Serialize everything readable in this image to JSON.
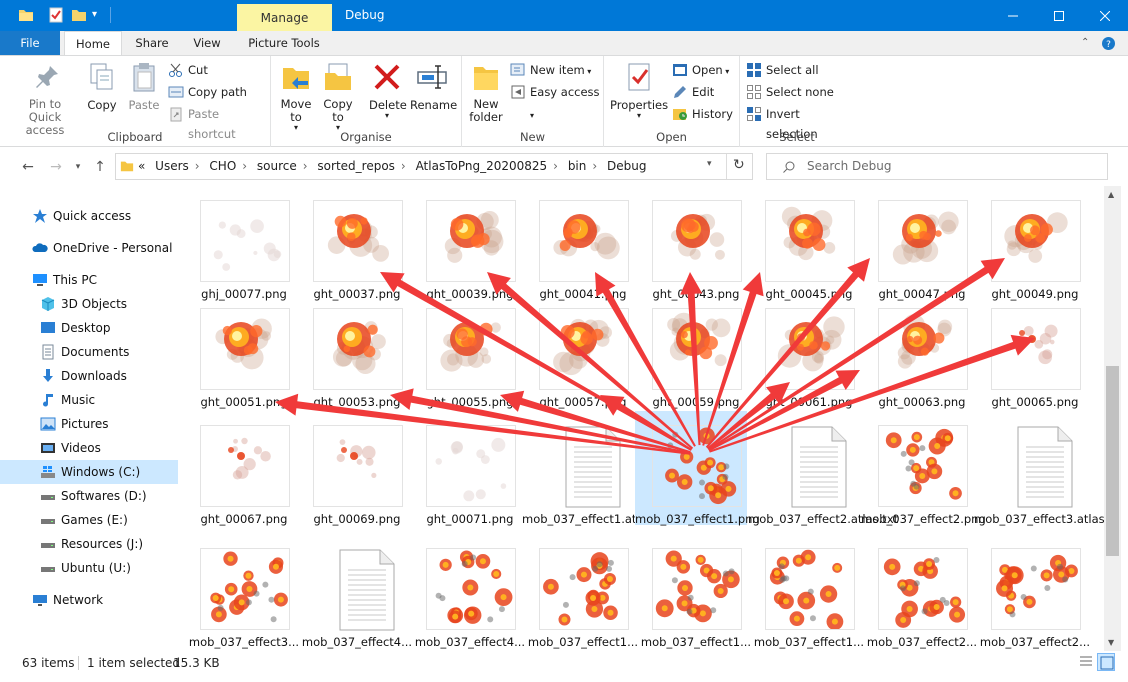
{
  "window": {
    "title": "Debug",
    "contextual_tab": "Manage",
    "accent": "#0078d7"
  },
  "ribbon_tabs": [
    "File",
    "Home",
    "Share",
    "View",
    "Picture Tools"
  ],
  "ribbon": {
    "clipboard": {
      "label": "Clipboard",
      "pin": "Pin to Quick access",
      "copy": "Copy",
      "paste": "Paste",
      "cut": "Cut",
      "copy_path": "Copy path",
      "paste_shortcut": "Paste shortcut"
    },
    "organise": {
      "label": "Organise",
      "move_to": "Move to",
      "copy_to": "Copy to",
      "delete": "Delete",
      "rename": "Rename"
    },
    "new": {
      "label": "New",
      "new_folder": "New folder",
      "new_item": "New item",
      "easy_access": "Easy access"
    },
    "open": {
      "label": "Open",
      "properties": "Properties",
      "open": "Open",
      "edit": "Edit",
      "history": "History"
    },
    "select": {
      "label": "Select",
      "select_all": "Select all",
      "select_none": "Select none",
      "invert": "Invert selection"
    }
  },
  "address": {
    "crumbs": [
      "«",
      "Users",
      "CHO",
      "source",
      "sorted_repos",
      "AtlasToPng_20200825",
      "bin",
      "Debug"
    ],
    "search_placeholder": "Search Debug"
  },
  "nav": {
    "quick_access": "Quick access",
    "onedrive": "OneDrive - Personal",
    "this_pc": "This PC",
    "objects": "3D Objects",
    "desktop": "Desktop",
    "documents": "Documents",
    "downloads": "Downloads",
    "music": "Music",
    "pictures": "Pictures",
    "videos": "Videos",
    "windows_c": "Windows (C:)",
    "softwares_d": "Softwares (D:)",
    "games_e": "Games (E:)",
    "resources_j": "Resources (J:)",
    "ubuntu_u": "Ubuntu (U:)",
    "network": "Network"
  },
  "files": [
    {
      "name": "ghj_00077.png",
      "kind": "faint"
    },
    {
      "name": "ght_00037.png",
      "kind": "fire"
    },
    {
      "name": "ght_00039.png",
      "kind": "fire"
    },
    {
      "name": "ght_00041.png",
      "kind": "fire"
    },
    {
      "name": "ght_00043.png",
      "kind": "fire"
    },
    {
      "name": "ght_00045.png",
      "kind": "fire"
    },
    {
      "name": "ght_00047.png",
      "kind": "fire"
    },
    {
      "name": "ght_00049.png",
      "kind": "fire"
    },
    {
      "name": "ght_00051.png",
      "kind": "fire"
    },
    {
      "name": "ght_00053.png",
      "kind": "fire"
    },
    {
      "name": "ght_00055.png",
      "kind": "fire"
    },
    {
      "name": "ght_00057.png",
      "kind": "fire"
    },
    {
      "name": "ght_00059.png",
      "kind": "fire"
    },
    {
      "name": "ght_00061.png",
      "kind": "fire"
    },
    {
      "name": "ght_00063.png",
      "kind": "fire"
    },
    {
      "name": "ght_00065.png",
      "kind": "small"
    },
    {
      "name": "ght_00067.png",
      "kind": "small"
    },
    {
      "name": "ght_00069.png",
      "kind": "small"
    },
    {
      "name": "ght_00071.png",
      "kind": "faint"
    },
    {
      "name": "mob_037_effect1.atlas.txt",
      "kind": "doc"
    },
    {
      "name": "mob_037_effect1.png",
      "kind": "atlas"
    },
    {
      "name": "mob_037_effect2.atlas.txt",
      "kind": "doc"
    },
    {
      "name": "mob_037_effect2.png",
      "kind": "atlas"
    },
    {
      "name": "mob_037_effect3.atlas.txt",
      "kind": "doc"
    },
    {
      "name": "mob_037_effect3...",
      "kind": "atlas"
    },
    {
      "name": "mob_037_effect4...",
      "kind": "doc"
    },
    {
      "name": "mob_037_effect4...",
      "kind": "atlas"
    },
    {
      "name": "mob_037_effect1...",
      "kind": "atlas"
    },
    {
      "name": "mob_037_effect1...",
      "kind": "atlas"
    },
    {
      "name": "mob_037_effect1...",
      "kind": "atlas"
    },
    {
      "name": "mob_037_effect2...",
      "kind": "atlas"
    },
    {
      "name": "mob_037_effect2...",
      "kind": "atlas"
    }
  ],
  "selected_index": 20,
  "status": {
    "count": "63 items",
    "selection": "1 item selected",
    "size": "15.3 KB"
  },
  "annotation_color": "#f03a3a"
}
